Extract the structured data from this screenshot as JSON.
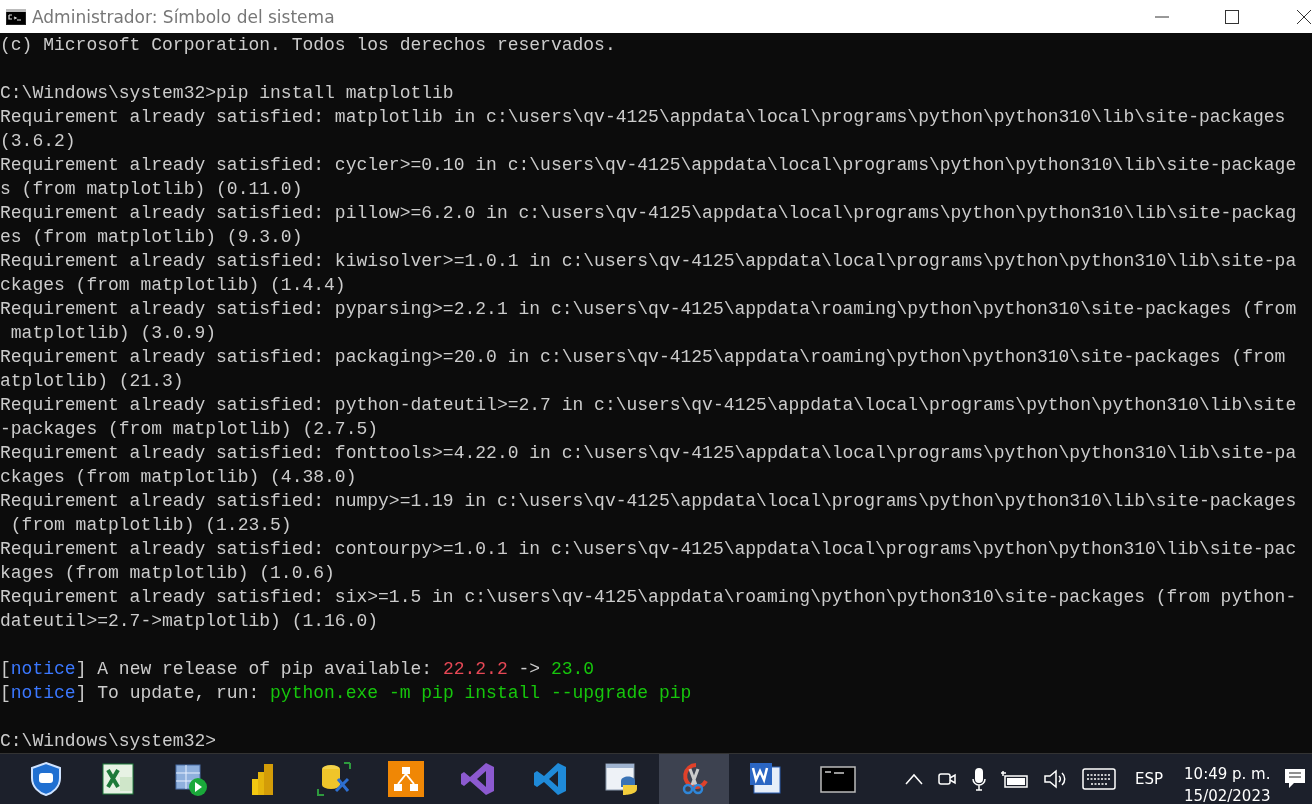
{
  "window": {
    "title": "Administrador: Símbolo del sistema"
  },
  "console": {
    "blocks": [
      {
        "lines": [
          [
            {
              "kind": "plain",
              "text": "(c) Microsoft Corporation. Todos los derechos reservados."
            }
          ]
        ]
      },
      {
        "lines": [
          [
            {
              "kind": "plain",
              "text": "C:\\Windows\\system32>pip install matplotlib"
            }
          ],
          [
            {
              "kind": "plain",
              "text": "Requirement already satisfied: matplotlib in c:\\users\\qv-4125\\appdata\\local\\programs\\python\\python310\\lib\\site-packages"
            }
          ],
          [
            {
              "kind": "plain",
              "text": "(3.6.2)"
            }
          ],
          [
            {
              "kind": "plain",
              "text": "Requirement already satisfied: cycler>=0.10 in c:\\users\\qv-4125\\appdata\\local\\programs\\python\\python310\\lib\\site-package"
            }
          ],
          [
            {
              "kind": "plain",
              "text": "s (from matplotlib) (0.11.0)"
            }
          ],
          [
            {
              "kind": "plain",
              "text": "Requirement already satisfied: pillow>=6.2.0 in c:\\users\\qv-4125\\appdata\\local\\programs\\python\\python310\\lib\\site-packag"
            }
          ],
          [
            {
              "kind": "plain",
              "text": "es (from matplotlib) (9.3.0)"
            }
          ],
          [
            {
              "kind": "plain",
              "text": "Requirement already satisfied: kiwisolver>=1.0.1 in c:\\users\\qv-4125\\appdata\\local\\programs\\python\\python310\\lib\\site-pa"
            }
          ],
          [
            {
              "kind": "plain",
              "text": "ckages (from matplotlib) (1.4.4)"
            }
          ],
          [
            {
              "kind": "plain",
              "text": "Requirement already satisfied: pyparsing>=2.2.1 in c:\\users\\qv-4125\\appdata\\roaming\\python\\python310\\site-packages (from"
            }
          ],
          [
            {
              "kind": "plain",
              "text": " matplotlib) (3.0.9)"
            }
          ],
          [
            {
              "kind": "plain",
              "text": "Requirement already satisfied: packaging>=20.0 in c:\\users\\qv-4125\\appdata\\roaming\\python\\python310\\site-packages (from"
            }
          ],
          [
            {
              "kind": "plain",
              "text": "atplotlib) (21.3)"
            }
          ],
          [
            {
              "kind": "plain",
              "text": "Requirement already satisfied: python-dateutil>=2.7 in c:\\users\\qv-4125\\appdata\\local\\programs\\python\\python310\\lib\\site"
            }
          ],
          [
            {
              "kind": "plain",
              "text": "-packages (from matplotlib) (2.7.5)"
            }
          ],
          [
            {
              "kind": "plain",
              "text": "Requirement already satisfied: fonttools>=4.22.0 in c:\\users\\qv-4125\\appdata\\local\\programs\\python\\python310\\lib\\site-pa"
            }
          ],
          [
            {
              "kind": "plain",
              "text": "ckages (from matplotlib) (4.38.0)"
            }
          ],
          [
            {
              "kind": "plain",
              "text": "Requirement already satisfied: numpy>=1.19 in c:\\users\\qv-4125\\appdata\\local\\programs\\python\\python310\\lib\\site-packages"
            }
          ],
          [
            {
              "kind": "plain",
              "text": " (from matplotlib) (1.23.5)"
            }
          ],
          [
            {
              "kind": "plain",
              "text": "Requirement already satisfied: contourpy>=1.0.1 in c:\\users\\qv-4125\\appdata\\local\\programs\\python\\python310\\lib\\site-pac"
            }
          ],
          [
            {
              "kind": "plain",
              "text": "kages (from matplotlib) (1.0.6)"
            }
          ],
          [
            {
              "kind": "plain",
              "text": "Requirement already satisfied: six>=1.5 in c:\\users\\qv-4125\\appdata\\roaming\\python\\python310\\site-packages (from python-"
            }
          ],
          [
            {
              "kind": "plain",
              "text": "dateutil>=2.7->matplotlib) (1.16.0)"
            }
          ]
        ]
      },
      {
        "lines": [
          [
            {
              "kind": "plain",
              "text": "["
            },
            {
              "kind": "notice",
              "text": "notice"
            },
            {
              "kind": "plain",
              "text": "] A new release of pip available: "
            },
            {
              "kind": "old",
              "text": "22.2.2"
            },
            {
              "kind": "plain",
              "text": " -> "
            },
            {
              "kind": "new",
              "text": "23.0"
            }
          ],
          [
            {
              "kind": "plain",
              "text": "["
            },
            {
              "kind": "notice",
              "text": "notice"
            },
            {
              "kind": "plain",
              "text": "] To update, run: "
            },
            {
              "kind": "new",
              "text": "python.exe -m pip install --upgrade pip"
            }
          ]
        ]
      },
      {
        "lines": [
          [
            {
              "kind": "plain",
              "text": "C:\\Windows\\system32>"
            }
          ]
        ]
      }
    ]
  },
  "taskbar": {
    "apps": [
      {
        "kind": "shield",
        "selected": false
      },
      {
        "kind": "excel",
        "selected": false
      },
      {
        "kind": "table-play",
        "selected": false
      },
      {
        "kind": "bars",
        "selected": false
      },
      {
        "kind": "database-tools",
        "selected": false
      },
      {
        "kind": "diagram",
        "selected": false
      },
      {
        "kind": "vs",
        "selected": false
      },
      {
        "kind": "vscode",
        "selected": false
      },
      {
        "kind": "python-window",
        "selected": false
      },
      {
        "kind": "scissors",
        "selected": true
      },
      {
        "kind": "word",
        "selected": false
      },
      {
        "kind": "terminal",
        "selected": false
      }
    ],
    "language": "ESP",
    "time": "10:49 p. m.",
    "date": "15/02/2023"
  }
}
